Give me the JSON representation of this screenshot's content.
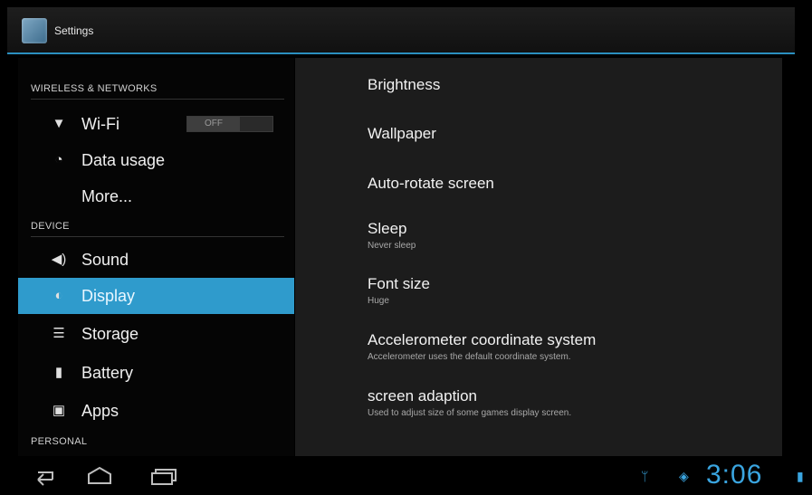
{
  "action_bar": {
    "title": "Settings"
  },
  "left_pane": {
    "headers": [
      "WIRELESS & NETWORKS",
      "DEVICE",
      "PERSONAL"
    ],
    "items": [
      {
        "label": "Wi-Fi",
        "icon": "wifi-icon"
      },
      {
        "label": "Data usage",
        "icon": "data-usage-icon"
      },
      {
        "label": "More...",
        "icon": ""
      },
      {
        "label": "Sound",
        "icon": "sound-icon"
      },
      {
        "label": "Display",
        "icon": "display-icon",
        "selected": true
      },
      {
        "label": "Storage",
        "icon": "storage-icon"
      },
      {
        "label": "Battery",
        "icon": "battery-icon"
      },
      {
        "label": "Apps",
        "icon": "apps-icon"
      }
    ],
    "wifi_toggle": "OFF"
  },
  "display_settings": [
    {
      "title": "Brightness",
      "summary": ""
    },
    {
      "title": "Wallpaper",
      "summary": ""
    },
    {
      "title": "Auto-rotate screen",
      "summary": ""
    },
    {
      "title": "Sleep",
      "summary": "Never sleep"
    },
    {
      "title": "Font size",
      "summary": "Huge"
    },
    {
      "title": "Accelerometer coordinate system",
      "summary": "Accelerometer uses the default coordinate system."
    },
    {
      "title": "screen adaption",
      "summary": "Used to adjust size of some games display screen."
    }
  ],
  "status_bar": {
    "time": "3:06"
  },
  "colors": {
    "accent": "#2f9bcc",
    "clock": "#3aa5e0"
  }
}
